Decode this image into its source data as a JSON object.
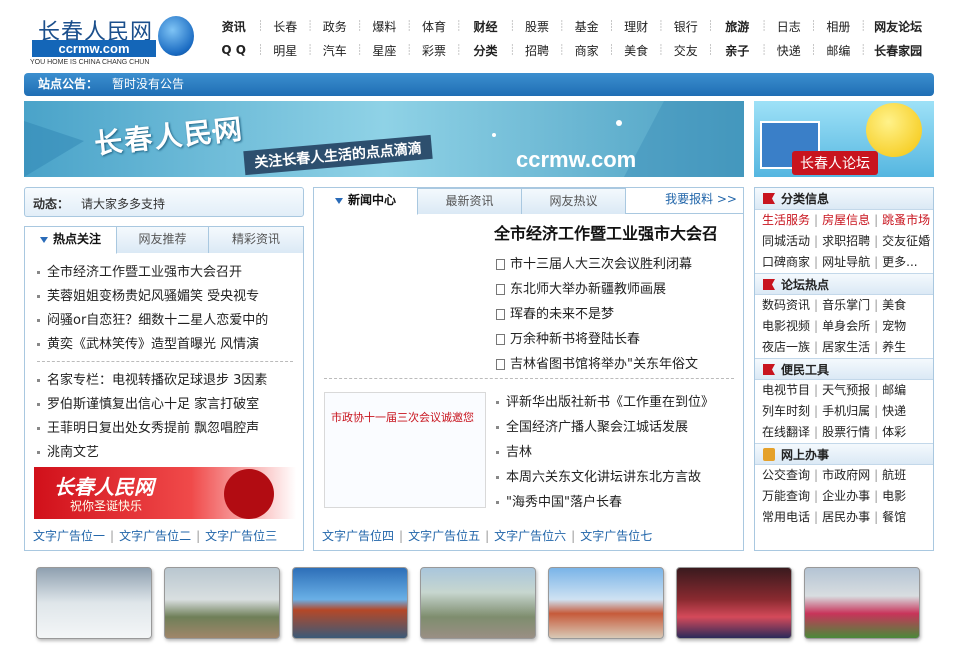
{
  "logo": {
    "name": "长春人民网",
    "domain": "ccrmw.com",
    "slogan": "YOU HOME IS CHINA CHANG CHUN"
  },
  "nav": {
    "row1": [
      "资讯",
      "长春",
      "政务",
      "爆料",
      "体育",
      "财经",
      "股票",
      "基金",
      "理财",
      "银行",
      "旅游",
      "日志",
      "相册",
      "网友论坛"
    ],
    "row2": [
      "Q Q",
      "明星",
      "汽车",
      "星座",
      "彩票",
      "分类",
      "招聘",
      "商家",
      "美食",
      "交友",
      "亲子",
      "快递",
      "邮编",
      "长春家园"
    ]
  },
  "notice": {
    "label": "站点公告：",
    "text": "暂时没有公告"
  },
  "banner": {
    "title": "长春人民网",
    "slogan": "关注长春人生活的点点滴滴",
    "domain": "ccrmw.com"
  },
  "bbs_banner": {
    "label": "长春人论坛"
  },
  "dynamic": {
    "label": "动态：",
    "text": "请大家多多支持"
  },
  "hot": {
    "tabs": [
      "热点关注",
      "网友推荐",
      "精彩资讯"
    ],
    "items1": [
      "全市经济工作暨工业强市大会召开",
      "芙蓉姐姐变杨贵妃风骚媚笑 受央视专",
      "闷骚or自恋狂？细数十二星人恋爱中的",
      "黄奕《武林笑传》造型首曝光 风情演"
    ],
    "items2": [
      "名家专栏：电视转播砍足球退步 3因素",
      "罗伯斯谨慎复出信心十足 家言打破室",
      "王菲明日复出处女秀提前 飘忽唱腔声",
      "洮南文艺"
    ],
    "xmas_ad": {
      "title": "长春人民网",
      "sub": "祝你圣诞快乐"
    },
    "ads": [
      "文字广告位一",
      "文字广告位二",
      "文字广告位三"
    ]
  },
  "news": {
    "tabs": [
      "新闻中心",
      "最新资讯",
      "网友热议"
    ],
    "report": "我要报料 >>",
    "headline": "全市经济工作暨工业强市大会召",
    "list1": [
      "市十三届人大三次会议胜利闭幕",
      "东北师大举办新疆教师画展",
      "珲春的未来不是梦",
      "万余种新书将登陆长春",
      "吉林省图书馆将举办\"关东年俗文"
    ],
    "invite": "市政协十一届三次会议诚邀您",
    "list2": [
      "评新华出版社新书《工作重在到位》",
      "全国经济广播人聚会江城话发展",
      "吉林",
      "本周六关东文化讲坛讲东北方言故",
      "\"海秀中国\"落户长春"
    ],
    "ads": [
      "文字广告位四",
      "文字广告位五",
      "文字广告位六",
      "文字广告位七"
    ]
  },
  "right": {
    "sections": [
      {
        "title": "分类信息",
        "icon": "flag-icon",
        "rows": [
          [
            "生活服务",
            "房屋信息",
            "跳蚤市场"
          ],
          [
            "同城活动",
            "求职招聘",
            "交友征婚"
          ],
          [
            "口碑商家",
            "网址导航",
            "更多..."
          ]
        ]
      },
      {
        "title": "论坛热点",
        "icon": "flag-icon",
        "rows": [
          [
            "数码资讯",
            "音乐掌门",
            "美食"
          ],
          [
            "电影视频",
            "单身会所",
            "宠物"
          ],
          [
            "夜店一族",
            "居家生活",
            "养生"
          ]
        ]
      },
      {
        "title": "便民工具",
        "icon": "flag-icon",
        "rows": [
          [
            "电视节目",
            "天气预报",
            "邮编"
          ],
          [
            "列车时刻",
            "手机归属",
            "快递"
          ],
          [
            "在线翻译",
            "股票行情",
            "体彩"
          ]
        ]
      },
      {
        "title": "网上办事",
        "icon": "thumb-icon",
        "rows": [
          [
            "公交查询",
            "市政府网",
            "航班"
          ],
          [
            "万能查询",
            "企业办事",
            "电影"
          ],
          [
            "常用电话",
            "居民办事",
            "餐馆"
          ]
        ]
      }
    ]
  },
  "colors": {
    "accent": "#1f6eb4",
    "red": "#c8141e",
    "border": "#a9c8e0"
  }
}
